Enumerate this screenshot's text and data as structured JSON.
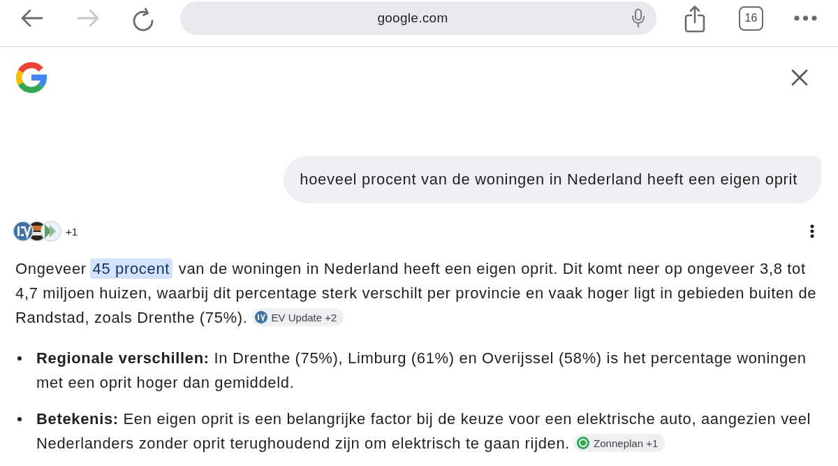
{
  "toolbar": {
    "back": {
      "disabled": false
    },
    "forward": {
      "disabled": true
    },
    "address": "google.com",
    "tab_count": "16"
  },
  "query": "hoeveel procent van de woningen in Nederland heeft een eigen oprit",
  "sources": {
    "more": "+1"
  },
  "answer": {
    "segments": [
      {
        "text": "Ongeveer ",
        "highlighted": false
      },
      {
        "text": "45 procent",
        "highlighted": true
      },
      {
        "text": " van de woningen in Nederland heeft een eigen oprit. Dit komt neer op ongeveer 3,8 tot 4,7 miljoen huizen, waarbij dit percentage sterk verschilt per provincie en vaak hoger ligt in gebieden buiten de Randstad, zoals Drenthe (75%).",
        "highlighted": false
      }
    ],
    "citation": {
      "kind": "monogram",
      "label": "EV Update +2"
    }
  },
  "bullets": [
    {
      "text": "**Regionale verschillen:** In Drenthe (75%), Limburg (61%) en Overijssel (58%) is het percentage woningen met een oprit hoger dan gemiddeld."
    },
    {
      "text": "**Betekenis:** Een eigen oprit is een belangrijke factor bij de keuze voor een elektrische auto, aangezien veel Nederlanders zonder oprit terughoudend zijn om elektrisch te gaan rijden.",
      "citation": {
        "kind": "ring",
        "label": "Zonneplan +1"
      }
    }
  ]
}
